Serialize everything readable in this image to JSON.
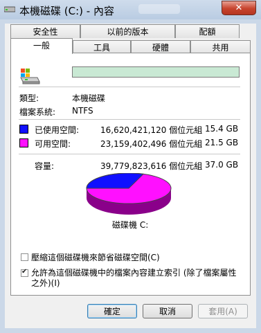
{
  "window": {
    "title": "本機磁碟 (C:) - 內容",
    "close_label": "✕"
  },
  "tabs": {
    "row1": [
      "安全性",
      "以前的版本",
      "配額"
    ],
    "row2": [
      "一般",
      "工具",
      "硬體",
      "共用"
    ]
  },
  "general": {
    "name_value": "",
    "type_label": "類型:",
    "type_value": "本機磁碟",
    "fs_label": "檔案系統:",
    "fs_value": "NTFS",
    "used": {
      "label": "已使用空間:",
      "bytes": "16,620,421,120 個位元組",
      "size": "15.4 GB",
      "color": "#1010ff"
    },
    "free": {
      "label": "可用空間:",
      "bytes": "23,159,402,496 個位元組",
      "size": "21.5 GB",
      "color": "#ff10ff"
    },
    "capacity": {
      "label": "容量:",
      "bytes": "39,779,823,616 個位元組",
      "size": "37.0 GB"
    },
    "drive_label": "磁碟機 C:",
    "compress_label": "壓縮這個磁碟機來節省磁碟空間(C)",
    "compress_checked": false,
    "index_label_line1": "允許為這個磁碟機中的檔案內容建立索引 (除了檔案屬性",
    "index_label_line2": "之外)(I)",
    "index_checked": true
  },
  "buttons": {
    "ok": "確定",
    "cancel": "取消",
    "apply": "套用(A)"
  }
}
